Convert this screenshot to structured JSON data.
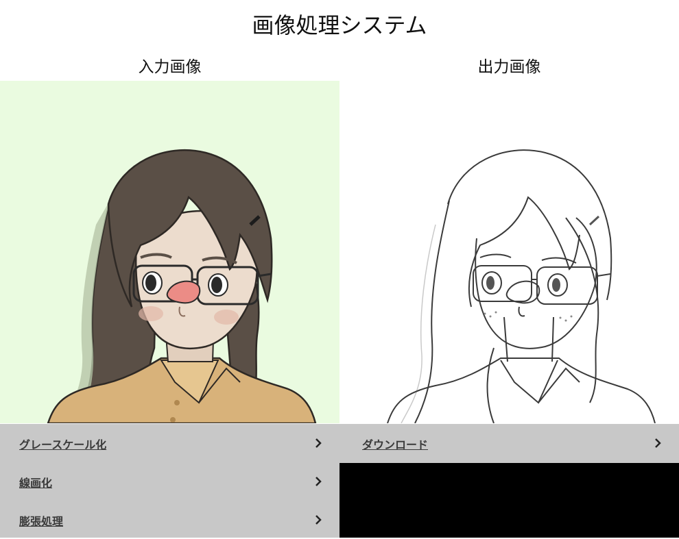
{
  "title": "画像処理システム",
  "input_panel": {
    "heading": "入力画像"
  },
  "output_panel": {
    "heading": "出力画像"
  },
  "left_menu": {
    "items": [
      {
        "label": "グレースケール化",
        "icon": "chevron-right-icon"
      },
      {
        "label": "線画化",
        "icon": "chevron-right-icon"
      },
      {
        "label": "膨張処理",
        "icon": "chevron-right-icon"
      }
    ]
  },
  "right_menu": {
    "items": [
      {
        "label": "ダウンロード",
        "icon": "chevron-right-icon"
      }
    ]
  },
  "colors": {
    "menu_background": "#c8c8c8",
    "input_background": "#eafbe0",
    "hair": "#5a4f46",
    "shirt": "#d8b27a",
    "skin": "#ecdccd",
    "output_box": "#000000"
  }
}
